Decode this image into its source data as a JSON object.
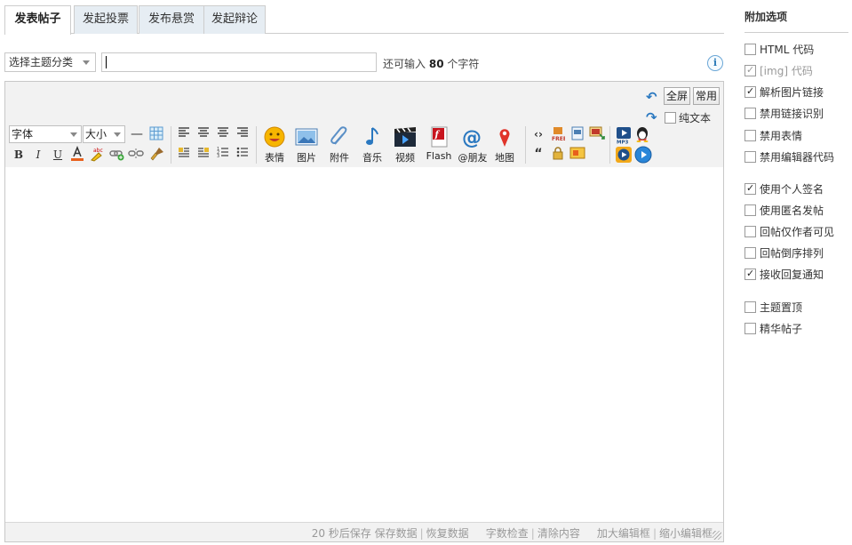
{
  "tabs": [
    {
      "label": "发表帖子",
      "active": true
    },
    {
      "label": "发起投票",
      "active": false
    },
    {
      "label": "发布悬赏",
      "active": false
    },
    {
      "label": "发起辩论",
      "active": false
    }
  ],
  "subject": {
    "category_select": "选择主题分类",
    "input_value": "",
    "hint_prefix": "还可输入",
    "hint_count": "80",
    "hint_suffix": "个字符",
    "info_icon": "i"
  },
  "editor": {
    "fullscreen_label": "全屏",
    "common_label": "常用",
    "plain_text_label": "纯文本",
    "plain_text_checked": false,
    "font_select": "字体",
    "size_select": "大小",
    "insert_buttons": [
      {
        "label": "表情",
        "icon": "emoticon-icon"
      },
      {
        "label": "图片",
        "icon": "image-icon"
      },
      {
        "label": "附件",
        "icon": "attachment-icon"
      },
      {
        "label": "音乐",
        "icon": "music-icon"
      },
      {
        "label": "视频",
        "icon": "video-icon"
      },
      {
        "label": "Flash",
        "icon": "flash-icon"
      },
      {
        "label": "@朋友",
        "icon": "at-icon"
      },
      {
        "label": "地图",
        "icon": "map-pin-icon"
      }
    ],
    "status": {
      "autosave": "20 秒后保存",
      "save_data": "保存数据",
      "restore_data": "恢复数据",
      "word_check": "字数检查",
      "clear_content": "清除内容",
      "enlarge": "加大编辑框",
      "shrink": "缩小编辑框"
    }
  },
  "sidebar": {
    "title": "附加选项",
    "options": [
      {
        "label": "HTML 代码",
        "checked": false,
        "disabled": false
      },
      {
        "label": "[img] 代码",
        "checked": true,
        "disabled": true
      },
      {
        "label": "解析图片链接",
        "checked": true,
        "disabled": false
      },
      {
        "label": "禁用链接识别",
        "checked": false,
        "disabled": false
      },
      {
        "label": "禁用表情",
        "checked": false,
        "disabled": false
      },
      {
        "label": "禁用编辑器代码",
        "checked": false,
        "disabled": false
      },
      {
        "label": "使用个人签名",
        "checked": true,
        "disabled": false
      },
      {
        "label": "使用匿名发帖",
        "checked": false,
        "disabled": false
      },
      {
        "label": "回帖仅作者可见",
        "checked": false,
        "disabled": false
      },
      {
        "label": "回帖倒序排列",
        "checked": false,
        "disabled": false
      },
      {
        "label": "接收回复通知",
        "checked": true,
        "disabled": false
      },
      {
        "label": "主题置顶",
        "checked": false,
        "disabled": false
      },
      {
        "label": "精华帖子",
        "checked": false,
        "disabled": false
      }
    ]
  },
  "colors": {
    "tab_bg": "#e6edf3",
    "border": "#cdcdcd",
    "toolbar_bg": "#f2f2f2",
    "accent_blue": "#2a78c0"
  }
}
